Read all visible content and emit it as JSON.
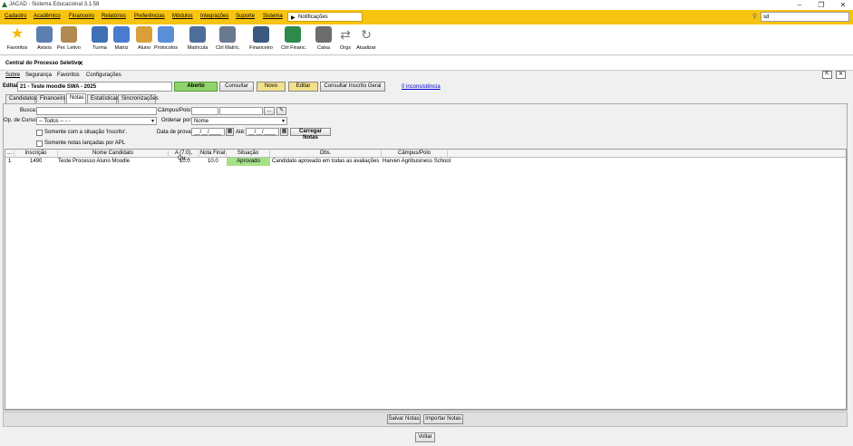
{
  "window": {
    "title": "JACAD - Sistema Educacional 3.1.58"
  },
  "menu": {
    "items": [
      "Cadastro",
      "Acadêmico",
      "Financeiro",
      "Relatórios",
      "Preferências",
      "Módulos",
      "Integrações",
      "Suporte",
      "Sistema"
    ],
    "notifications": "Notificações",
    "search_value": "sd"
  },
  "toolbar": {
    "items": [
      {
        "label": "Favoritos",
        "icon": "star-icon",
        "color": "#f5b800"
      },
      {
        "label": "Avisos",
        "icon": "envelope-icon",
        "color": "#5d7fb0"
      },
      {
        "label": "Per. Letivo",
        "icon": "calendar-icon",
        "color": "#b08a50"
      },
      {
        "label": "Turma",
        "icon": "class-icon",
        "color": "#3f6fb5"
      },
      {
        "label": "Matriz",
        "icon": "matrix-icon",
        "color": "#4a7bd0"
      },
      {
        "label": "Aluno",
        "icon": "student-icon",
        "color": "#d9a03a"
      },
      {
        "label": "Protocolos",
        "icon": "protocol-icon",
        "color": "#5a8fd8"
      },
      {
        "label": "Matrícula",
        "icon": "enrollment-icon",
        "color": "#4d6e9a"
      },
      {
        "label": "Ctrl Matríc.",
        "icon": "enrollment-control-icon",
        "color": "#6a7a8e"
      },
      {
        "label": "Financeiro",
        "icon": "finance-icon",
        "color": "#3b5a80"
      },
      {
        "label": "Ctrl Financ.",
        "icon": "finance-control-icon",
        "color": "#2d8a4a"
      },
      {
        "label": "Caixa",
        "icon": "cash-register-icon",
        "color": "#6d6d6d"
      },
      {
        "label": "Orgs",
        "icon": "orgs-icon",
        "color": "#777777"
      },
      {
        "label": "Atualizar",
        "icon": "refresh-icon",
        "color": "#777777"
      }
    ]
  },
  "tab": {
    "title": "Central do Processo Seletivo",
    "close": "✕"
  },
  "submenu": [
    "Sobre",
    "Segurança",
    "Favoritos",
    "Configurações"
  ],
  "edit": {
    "label": "Editai:",
    "value": "21 - Teste moodle SWA - 2025",
    "status": "Aberto",
    "buttons": [
      "Consultar",
      "Novo",
      "Editar",
      "Consultar Inscrito Geral"
    ],
    "inconsistency_link": "0 inconsistência"
  },
  "subtabs": [
    "Candidatos",
    "Financeiro",
    "Notas",
    "Estatísticas",
    "Sincronizações"
  ],
  "filters": {
    "busca_label": "Busca:",
    "campus_label": "Câmpus/Polo:",
    "campus_btn": "...",
    "opcurso_label": "Op. de Curso:",
    "opcurso_value": "-- Todos -- - -",
    "ordenar_label": "Ordenar por:",
    "ordenar_value": "Nome",
    "chk_inscrito": "Somente com a situação 'Inscrito'.",
    "chk_apl": "Somente notas lançadas por APL",
    "dataprova_label": "Data de prova:",
    "date_from": "__/__/____",
    "ate_label": "Até:",
    "date_to": "__/__/____",
    "carregar": "Carregar Notas"
  },
  "grid": {
    "columns": [
      "...",
      "Inscrição",
      "Nome Candidato",
      "A (7.0), Qu...",
      "Nota Final",
      "Situação",
      "Obs.",
      "Câmpus/Polo"
    ],
    "rows": [
      [
        "1",
        "1490",
        "Teste Processo Aluno Moodle",
        "10.0",
        "10.0",
        "Aprovado",
        "Candidato aprovado em todas as avaliações",
        "Harven Agribusiness School"
      ]
    ]
  },
  "bottom": {
    "salvar": "Salvar Notas",
    "importar": "Importar Notas",
    "voltar": "Voltar"
  },
  "colors": {
    "menubar": "#f7c411",
    "aberto": "#8fd46b",
    "novo_editar": "#f3e08a",
    "aprovado": "#a6e08a"
  }
}
